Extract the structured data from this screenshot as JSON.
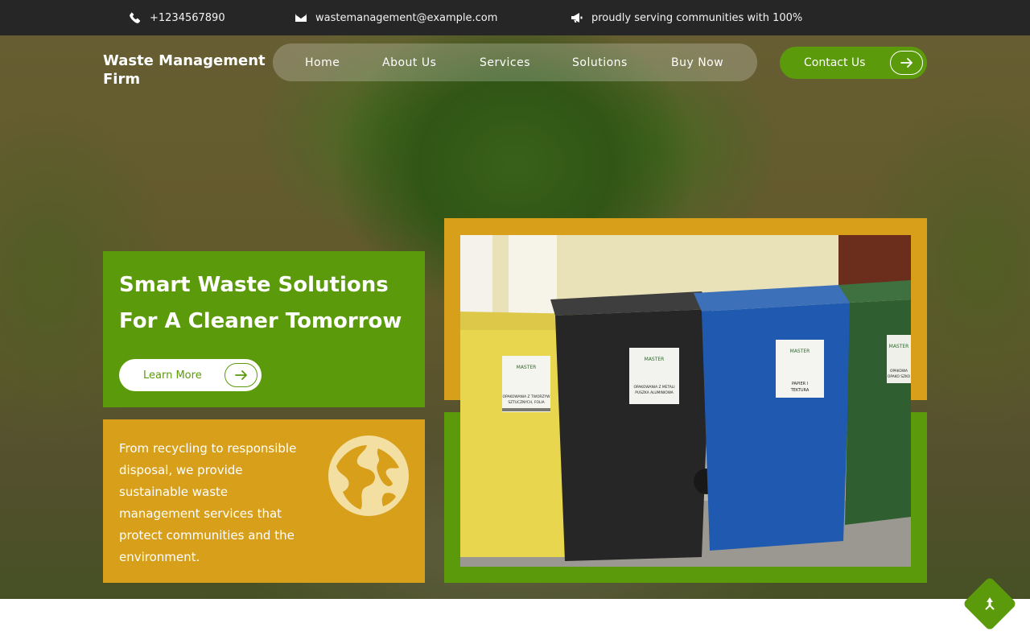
{
  "topbar": {
    "phone": "+1234567890",
    "email": "wastemanagement@example.com",
    "announcement": "proudly serving communities with 100%"
  },
  "header": {
    "logo_text": "Waste Management Firm",
    "nav": [
      "Home",
      "About Us",
      "Services",
      "Solutions",
      "Buy Now"
    ],
    "contact_label": "Contact Us"
  },
  "hero": {
    "title": "Smart Waste Solutions For A Cleaner Tomorrow",
    "learn_more_label": "Learn More",
    "description": "From recycling to responsible disposal, we provide sustainable waste management services that protect communities and the environment."
  },
  "bins": [
    {
      "color": "#e7cf3c",
      "sticker_line1": "OPAKOWANIA Z TWORZYW",
      "sticker_line2": "SZTUCZNYCH, FOLIA"
    },
    {
      "color": "#2b2b2b",
      "sticker_line1": "OPAKOWANIA Z METALI",
      "sticker_line2": "PUSZKA ALUMINIOWA"
    },
    {
      "color": "#1f5ab0",
      "sticker_line1": "PAPIER I",
      "sticker_line2": "TEKTURA"
    },
    {
      "color": "#2f5e30",
      "sticker_line1": "OPAKOWA",
      "sticker_line2": "OPAKO SZKO"
    }
  ],
  "sticker_brand": "MASTER",
  "colors": {
    "green": "#5b9a0a",
    "gold": "#d8a01a",
    "topbar": "#262626"
  },
  "icons": [
    "phone-icon",
    "envelope-icon",
    "megaphone-icon",
    "arrow-right-icon",
    "globe-icon",
    "arrow-up-icon"
  ]
}
